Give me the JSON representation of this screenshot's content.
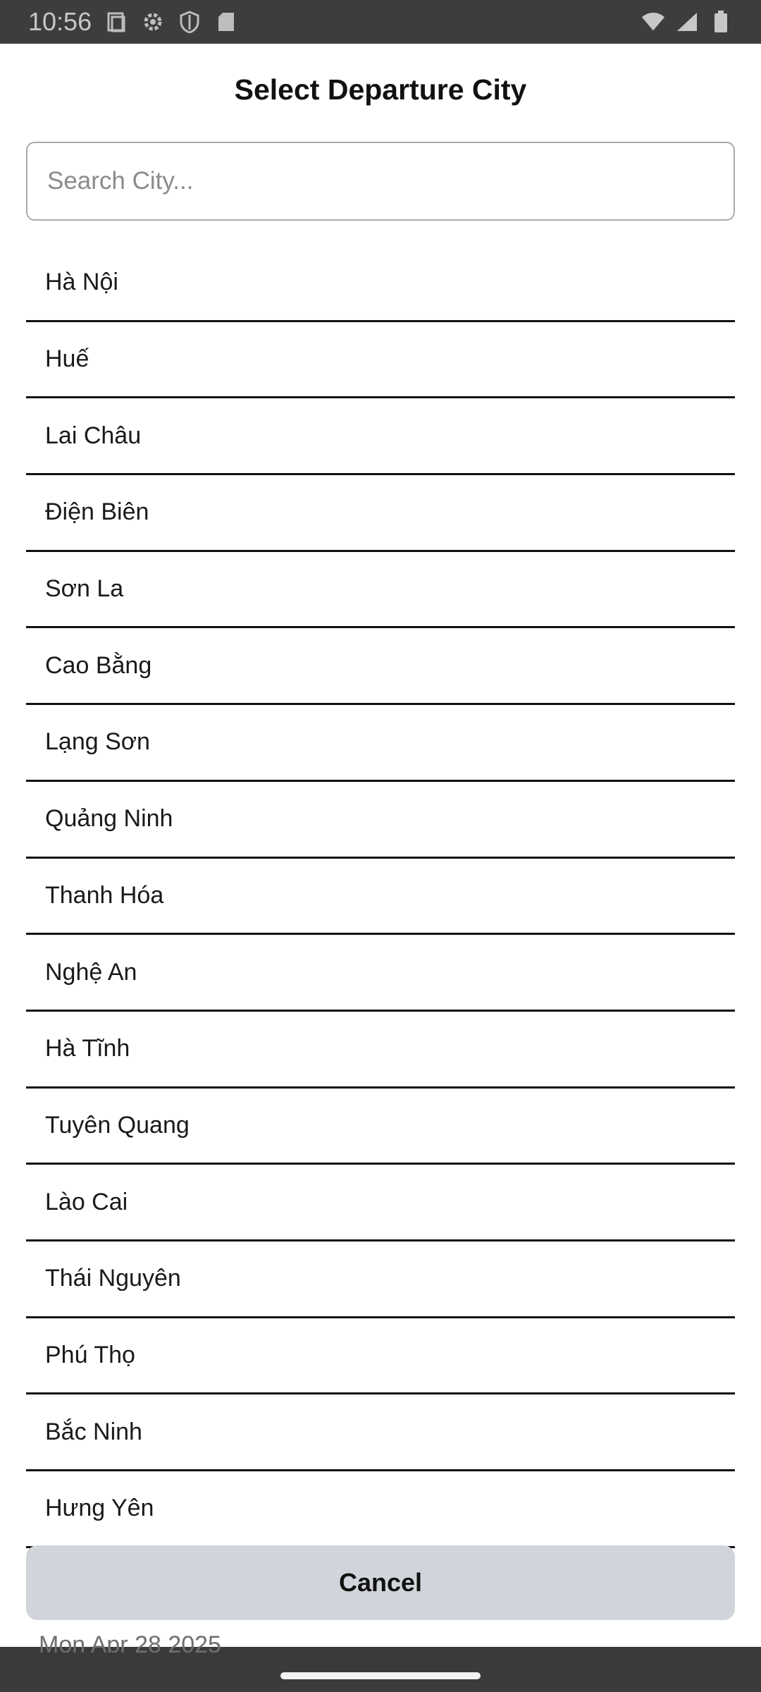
{
  "status": {
    "time": "10:56",
    "left_icons": [
      "clipboard-icon",
      "gear-icon",
      "shield-icon",
      "sd-card-icon"
    ],
    "right_icons": [
      "wifi-icon",
      "signal-icon",
      "battery-icon"
    ]
  },
  "sheet": {
    "title": "Select Departure City",
    "search_placeholder": "Search City...",
    "cities": [
      "Hà Nội",
      "Huế",
      "Lai Châu",
      "Điện Biên",
      "Sơn La",
      "Cao Bằng",
      "Lạng Sơn",
      "Quảng Ninh",
      "Thanh Hóa",
      "Nghệ An",
      "Hà Tĩnh",
      "Tuyên Quang",
      "Lào Cai",
      "Thái Nguyên",
      "Phú Thọ",
      "Bắc Ninh",
      "Hưng Yên"
    ],
    "cancel_label": "Cancel"
  },
  "background": {
    "date_text": "Mon Apr 28 2025"
  }
}
